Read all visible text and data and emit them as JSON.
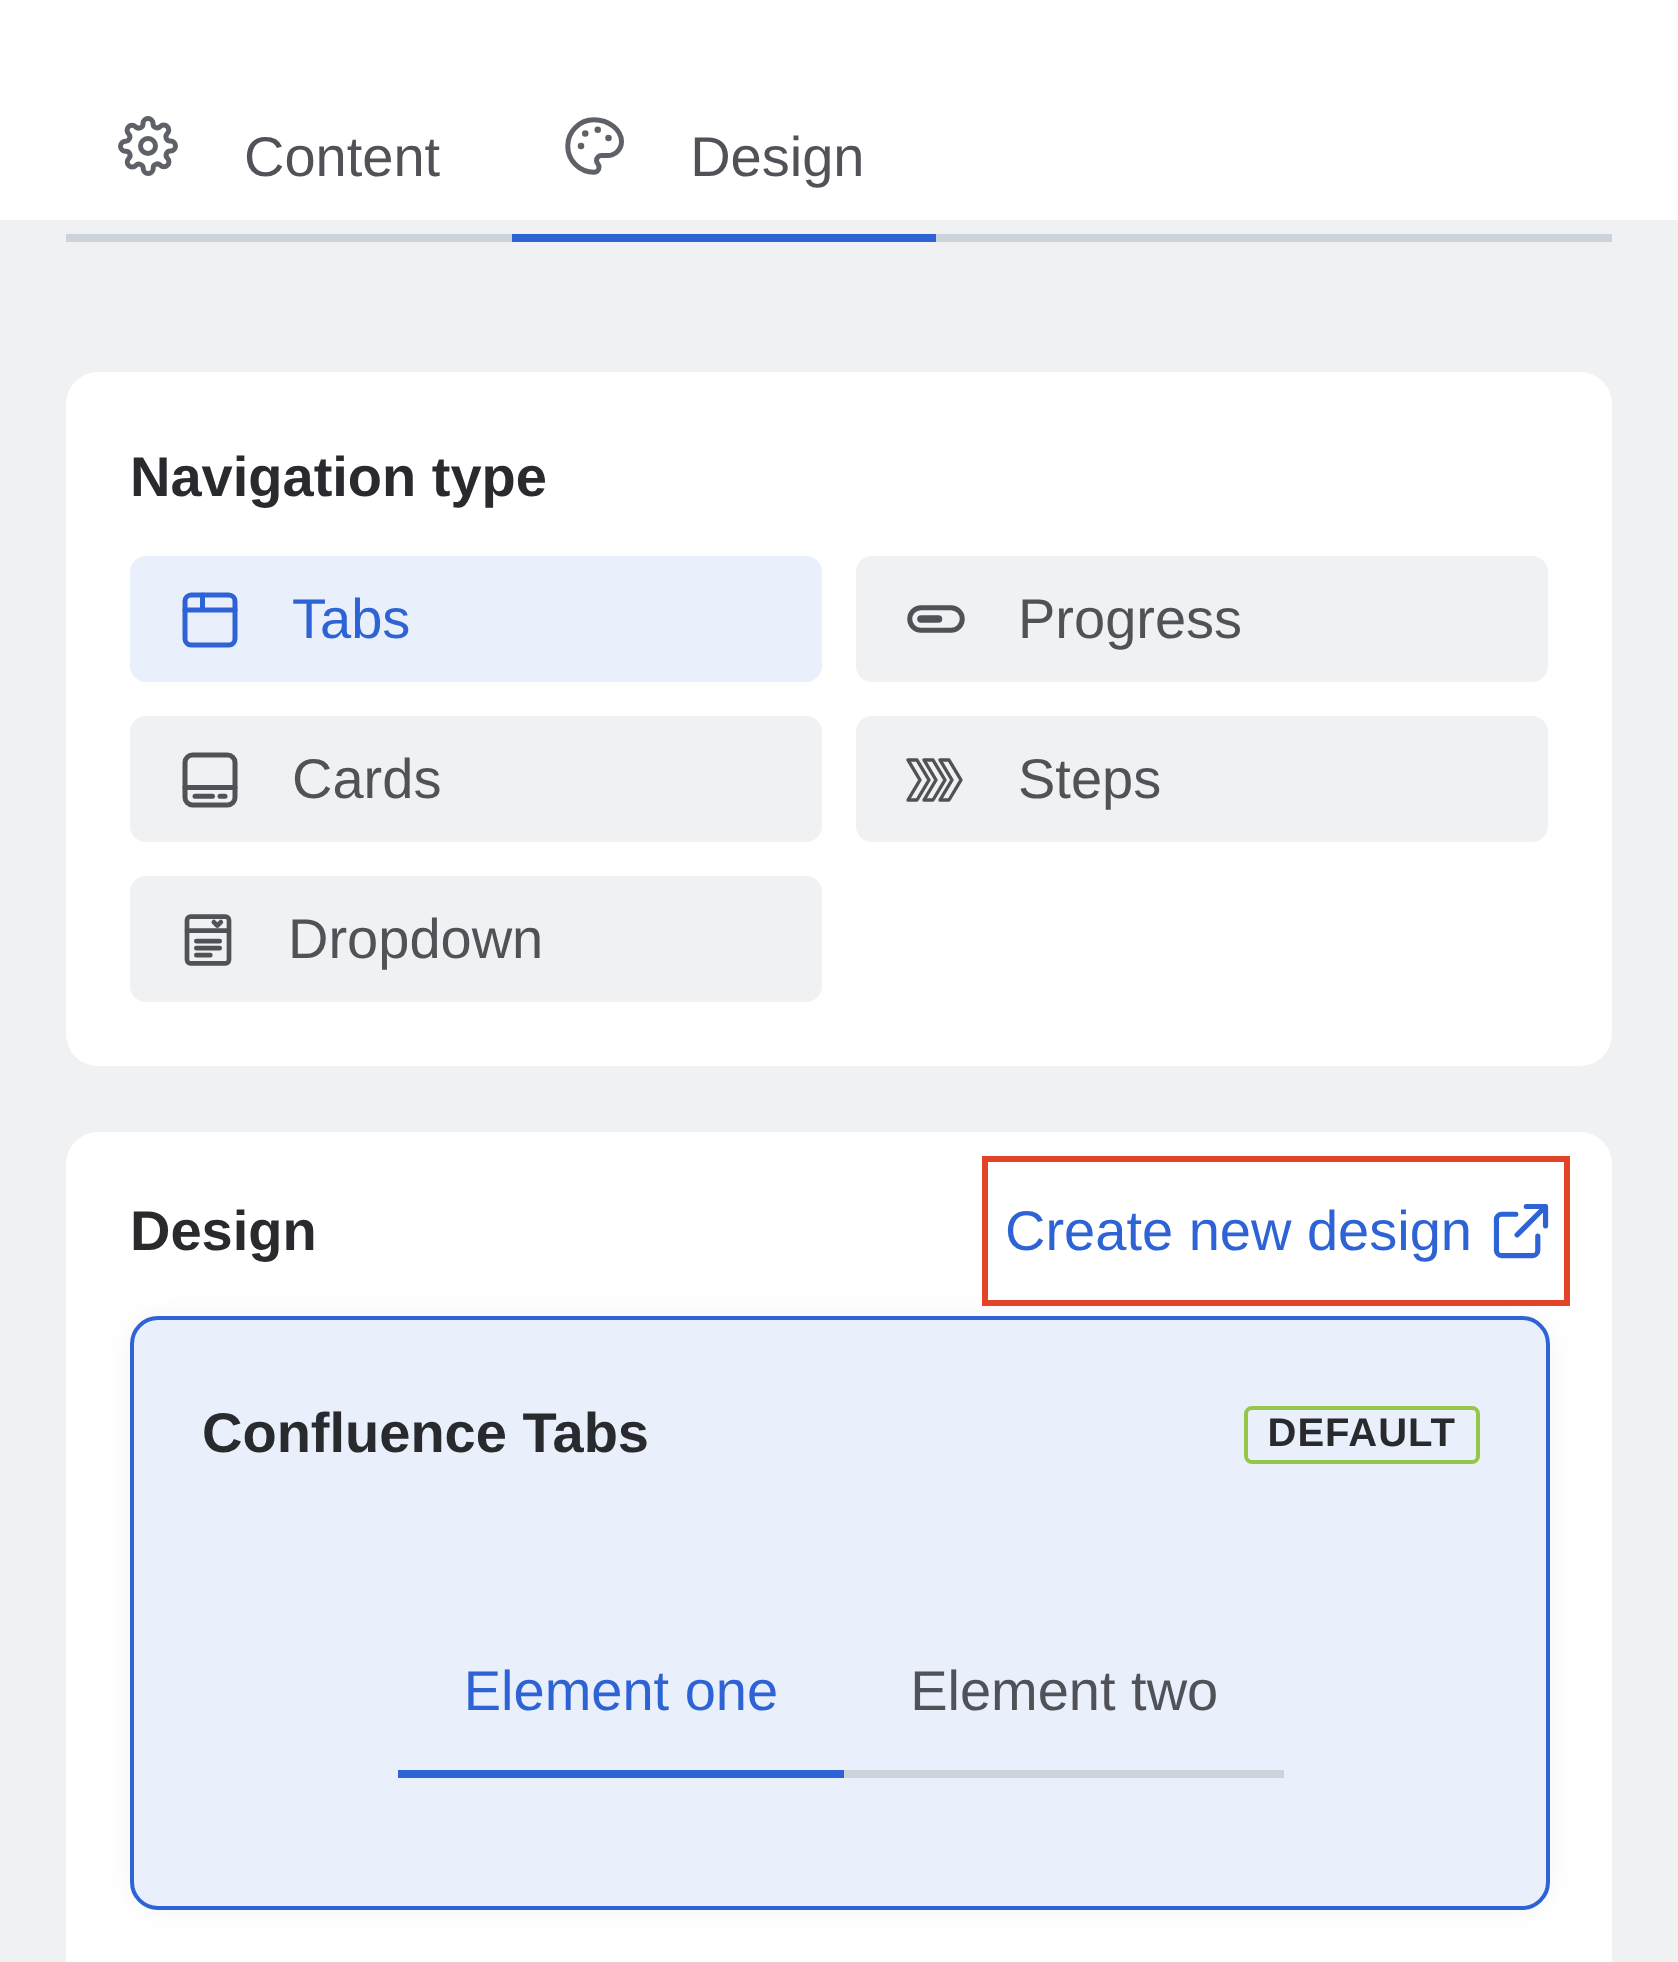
{
  "tabs": [
    {
      "kind": "content",
      "label": "Content",
      "selected": false
    },
    {
      "kind": "design",
      "label": "Design",
      "selected": true
    }
  ],
  "navigation_type": {
    "title": "Navigation type",
    "options": [
      {
        "kind": "tabs",
        "label": "Tabs",
        "selected": true
      },
      {
        "kind": "progress",
        "label": "Progress",
        "selected": false
      },
      {
        "kind": "cards",
        "label": "Cards",
        "selected": false
      },
      {
        "kind": "steps",
        "label": "Steps",
        "selected": false
      },
      {
        "kind": "dropdown",
        "label": "Dropdown",
        "selected": false
      }
    ]
  },
  "design": {
    "title": "Design",
    "create_link": {
      "label": "Create new design",
      "highlighted": true
    },
    "designs": [
      {
        "name": "Confluence Tabs",
        "badge": "DEFAULT",
        "selected": true,
        "preview_tabs": [
          {
            "label": "Element one",
            "selected": true
          },
          {
            "label": "Element two",
            "selected": false
          }
        ]
      }
    ]
  }
}
